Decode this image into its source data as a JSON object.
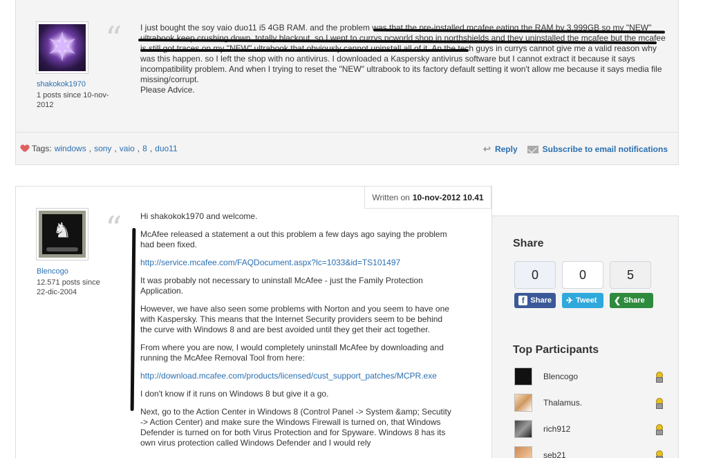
{
  "post1": {
    "user": {
      "name": "shakokok1970",
      "meta": "1 posts since 10-nov-2012"
    },
    "quote_mark": "“",
    "body": "I just bought the soy vaio duo11 i5 4GB RAM. and the problem was that the pre-installed mcafee eating the RAM by 3.999GB so my \"NEW\" ultrabook keep crushing down..totally blackout. so I went to currys pcworld shop in northshields and they uninstalled the mcafee but the mcafee is still got traces on my \"NEW\" ultrabook that obviously cannot uninstall all of it. An the tech guys in currys cannot give me a valid reason why was this happen. so I left the shop with no antivirus. I downloaded a Kaspersky antivirus software but I cannot extract it because it says incompatibility problem. And when I trying to reset the \"NEW\" ultrabook to its factory default setting it won't allow me because it says media file missing/corrupt.",
    "body_closing": "Please Advice.",
    "tags_label": "Tags:",
    "tags": [
      "windows",
      "sony",
      "vaio",
      "8",
      "duo11"
    ],
    "reply_label": "Reply",
    "subscribe_label": "Subscribe to email notifications"
  },
  "post2": {
    "written_prefix": "Written on",
    "written_date": "10-nov-2012 10.41",
    "user": {
      "name": "Blencogo",
      "meta": "12.571 posts since 22-dic-2004"
    },
    "quote_mark": "“",
    "paragraphs": [
      "Hi shakokok1970 and welcome.",
      "McAfee released a statement a out this problem a few days ago saying the problem had been fixed.",
      "http://service.mcafee.com/FAQDocument.aspx?lc=1033&id=TS101497",
      "It was probably not necessary to uninstall McAfee - just the Family Protection Application.",
      "However, we have also seen some problems with Norton and you seem to have one with Kaspersky.  This means that the Internet Security providers seem to be behind the curve with Windows 8 and are best avoided until they get their act together.",
      "From where you are now, I would completely uninstall McAfee by downloading and running the McAfee Removal Tool from here:",
      "http://download.mcafee.com/products/licensed/cust_support_patches/MCPR.exe",
      "I don't know if it runs on Windows 8 but give it a go.",
      "Next, go to the Action Center in Windows 8 (Control Panel -> System &amp; Secutity -> Action Center) and make sure the Windows Firewall is turned on, that Windows Defender is turned on for both Virus Protection and for Spyware. Windows 8 has its own virus protection called Windows Defender and I would rely"
    ]
  },
  "sidebar": {
    "share_title": "Share",
    "share_counts": [
      "0",
      "0",
      "5"
    ],
    "facebook_label": "Share",
    "twitter_label": "Tweet",
    "google_label": "Share",
    "top_title": "Top Participants",
    "participants": [
      "Blencogo",
      "Thalamus.",
      "rich912",
      "seb21"
    ]
  },
  "colors": {
    "link": "#2a6fb0",
    "facebook": "#3b5998",
    "twitter": "#2fa8dc",
    "google": "#2e8b3e"
  }
}
